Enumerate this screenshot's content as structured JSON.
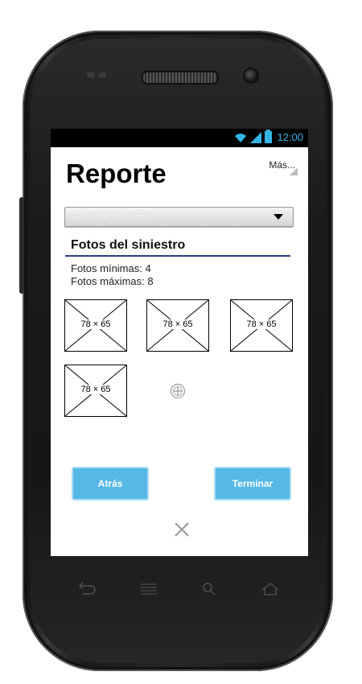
{
  "status_bar": {
    "time": "12:00"
  },
  "header": {
    "title": "Reporte",
    "more_label": "Más..."
  },
  "dropdown": {
    "value": "Accidente con carro"
  },
  "photos_section": {
    "title": "Fotos del siniestro",
    "min_text": "Fotos mínimas: 4",
    "max_text": "Fotos máximas: 8",
    "thumbnails": [
      {
        "label": "78 × 65"
      },
      {
        "label": "78 × 65"
      },
      {
        "label": "78 × 65"
      },
      {
        "label": "78 × 65"
      }
    ]
  },
  "actions": {
    "back_label": "Atrás",
    "finish_label": "Terminar"
  },
  "colors": {
    "accent": "#56b8e6",
    "status_accent": "#33b5e5",
    "section_line": "#2b3f7a"
  },
  "icons": [
    "wifi-icon",
    "signal-icon",
    "battery-icon",
    "add-photo-icon",
    "close-icon",
    "back-nav-icon",
    "menu-nav-icon",
    "search-nav-icon",
    "home-nav-icon"
  ]
}
